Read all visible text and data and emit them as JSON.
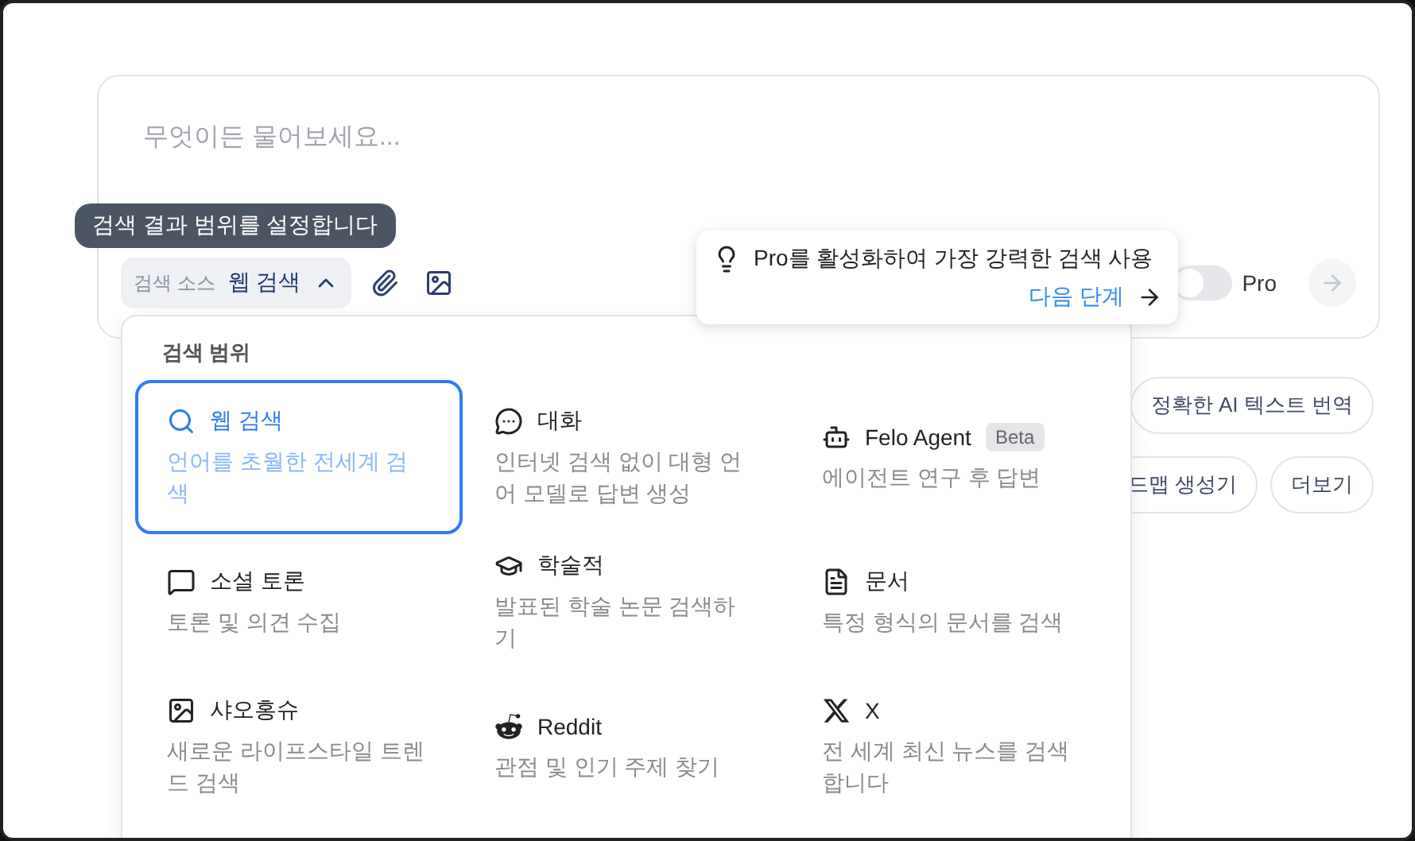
{
  "search_box": {
    "placeholder": "무엇이든 물어보세요...",
    "tooltip": "검색 결과 범위를 설정합니다",
    "source_label": "검색 소스",
    "source_value": "웹 검색",
    "source_expanded": true,
    "pro_toggle": {
      "label": "Pro",
      "on": false
    }
  },
  "pro_popover": {
    "text": "Pro를 활성화하여 가장 강력한 검색 사용",
    "link": "다음 단계"
  },
  "suggestion_rows": [
    [
      "정확한 AI 텍스트 번역"
    ],
    [
      "드맵 생성기",
      "더보기"
    ]
  ],
  "dropdown": {
    "title": "검색 범위",
    "items": [
      {
        "kind": "web",
        "title": "웹 검색",
        "description": "언어를 초월한 전세계 검색",
        "selected": true
      },
      {
        "kind": "chat",
        "title": "대화",
        "description": "인터넷 검색 없이 대형 언어 모델로 답변 생성",
        "selected": false
      },
      {
        "kind": "agent",
        "title": "Felo Agent",
        "badge": "Beta",
        "description": "에이전트 연구 후 답변",
        "selected": false
      },
      {
        "kind": "social",
        "title": "소셜 토론",
        "description": "토론 및 의견 수집",
        "selected": false
      },
      {
        "kind": "academic",
        "title": "학술적",
        "description": "발표된 학술 논문 검색하기",
        "selected": false
      },
      {
        "kind": "document",
        "title": "문서",
        "description": "특정 형식의 문서를 검색",
        "selected": false
      },
      {
        "kind": "image",
        "title": "샤오홍슈",
        "description": "새로운 라이프스타일 트렌드 검색",
        "selected": false
      },
      {
        "kind": "reddit",
        "title": "Reddit",
        "description": "관점 및 인기 주제 찾기",
        "selected": false
      },
      {
        "kind": "x",
        "title": "X",
        "description": "전 세계 최신 뉴스를 검색합니다",
        "selected": false
      }
    ]
  }
}
